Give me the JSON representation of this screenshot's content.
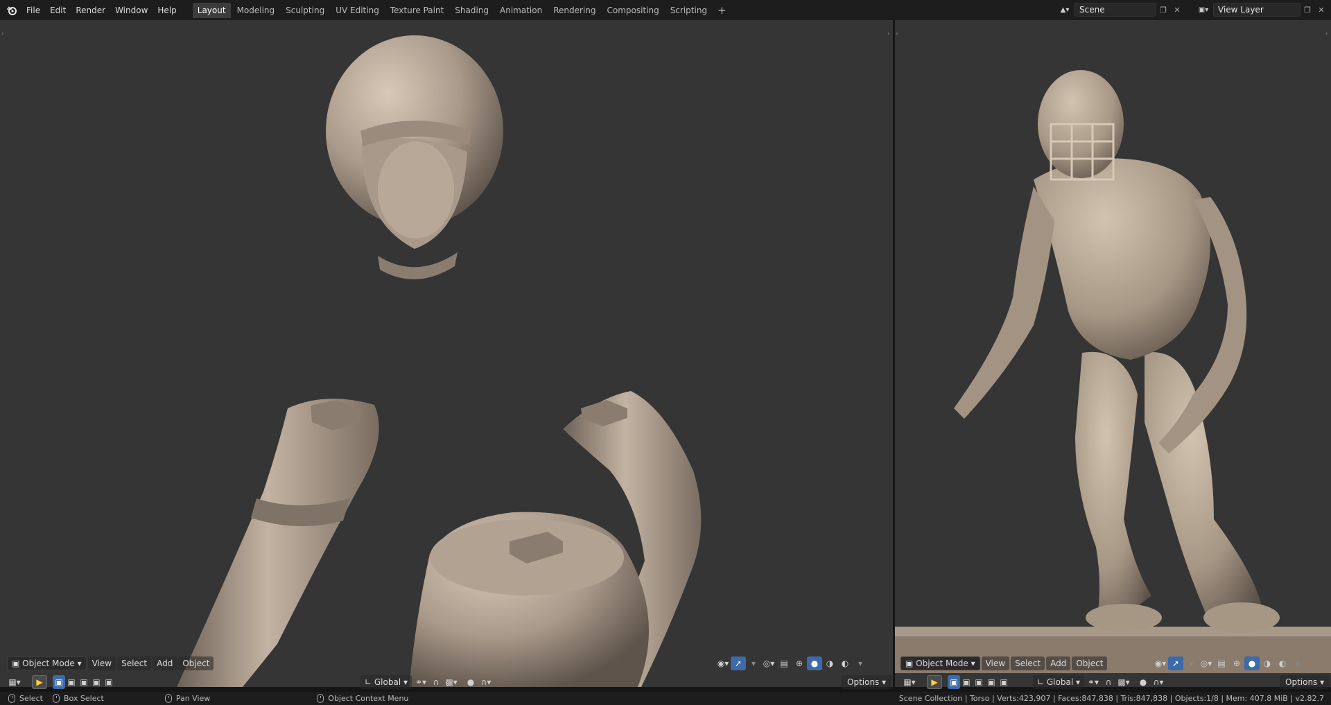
{
  "menu": [
    "File",
    "Edit",
    "Render",
    "Window",
    "Help"
  ],
  "workspaces": [
    {
      "label": "Layout",
      "active": true
    },
    {
      "label": "Modeling",
      "active": false
    },
    {
      "label": "Sculpting",
      "active": false
    },
    {
      "label": "UV Editing",
      "active": false
    },
    {
      "label": "Texture Paint",
      "active": false
    },
    {
      "label": "Shading",
      "active": false
    },
    {
      "label": "Animation",
      "active": false
    },
    {
      "label": "Rendering",
      "active": false
    },
    {
      "label": "Compositing",
      "active": false
    },
    {
      "label": "Scripting",
      "active": false
    }
  ],
  "add_tab": "+",
  "scene": {
    "label": "Scene"
  },
  "view_layer": {
    "label": "View Layer"
  },
  "viewport_left": {
    "mode": "Object Mode",
    "menus": [
      "View",
      "Select",
      "Add",
      "Object"
    ],
    "transform": "Global",
    "options": "Options"
  },
  "viewport_right": {
    "mode": "Object Mode",
    "menus": [
      "View",
      "Select",
      "Add",
      "Object"
    ],
    "transform": "Global",
    "options": "Options"
  },
  "status": {
    "select": "Select",
    "box_select": "Box Select",
    "pan_view": "Pan View",
    "context_menu": "Object Context Menu",
    "info": "Scene Collection | Torso | Verts:423,907 | Faces:847,838 | Tris:847,838 | Objects:1/8 | Mem: 407.8 MiB | v2.82.7"
  },
  "colors": {
    "clay": "#b4a493",
    "viewport_bg": "#353535",
    "accent": "#3d6aa8"
  },
  "icons": [
    "blender-logo-icon",
    "scene-icon",
    "view-layer-icon",
    "new-scene-icon",
    "close-icon",
    "viewport-type-icon",
    "select-tool-icon",
    "mode-set-icon",
    "global-orientation-icon",
    "snap-icon",
    "proportional-icon",
    "visibility-icon",
    "gizmo-icon",
    "overlay-icon",
    "xray-icon",
    "shading-wire-icon",
    "shading-solid-icon",
    "shading-material-icon",
    "shading-render-icon",
    "mouse-left-icon",
    "mouse-middle-icon",
    "mouse-right-icon"
  ]
}
